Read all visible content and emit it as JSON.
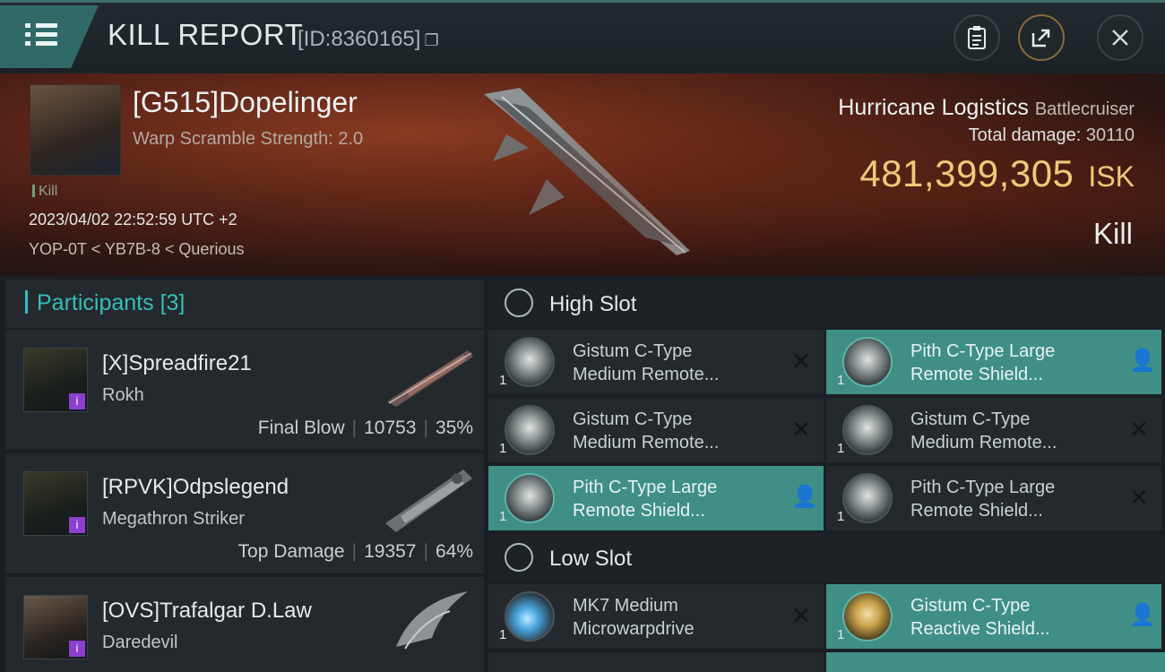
{
  "header": {
    "title": "KILL REPORT",
    "report_id": "[ID:8360165]"
  },
  "victim": {
    "name": "[G515]Dopelinger",
    "scramble": "Warp Scramble Strength: 2.0",
    "tag": "Kill",
    "datetime": "2023/04/02 22:52:59 UTC +2",
    "route": "YOP-0T < YB7B-8 < Querious",
    "ship": "Hurricane Logistics",
    "ship_class": "Battlecruiser",
    "total_damage_label": "Total damage:",
    "total_damage": "30110",
    "isk_value": "481,399,305",
    "isk_unit": "ISK",
    "result": "Kill"
  },
  "participants": {
    "title": "Participants",
    "count": "[3]",
    "rows": [
      {
        "name": "[X]Spreadfire21",
        "ship": "Rokh",
        "label": "Final Blow",
        "damage": "10753",
        "pct": "35%"
      },
      {
        "name": "[RPVK]Odpslegend",
        "ship": "Megathron Striker",
        "label": "Top Damage",
        "damage": "19357",
        "pct": "64%"
      },
      {
        "name": "[OVS]Trafalgar D.Law",
        "ship": "Daredevil",
        "label": "",
        "damage": "",
        "pct": ""
      }
    ]
  },
  "slots": {
    "high": {
      "title": "High Slot",
      "modules": [
        {
          "line1": "Gistum C-Type",
          "line2": "Medium Remote...",
          "qty": "1",
          "highlight": false,
          "action": "x"
        },
        {
          "line1": "Pith C-Type Large",
          "line2": "Remote Shield...",
          "qty": "1",
          "highlight": true,
          "action": "user"
        },
        {
          "line1": "Gistum C-Type",
          "line2": "Medium Remote...",
          "qty": "1",
          "highlight": false,
          "action": "x"
        },
        {
          "line1": "Gistum C-Type",
          "line2": "Medium Remote...",
          "qty": "1",
          "highlight": false,
          "action": "x"
        },
        {
          "line1": "Pith C-Type Large",
          "line2": "Remote Shield...",
          "qty": "1",
          "highlight": true,
          "action": "user"
        },
        {
          "line1": "Pith C-Type Large",
          "line2": "Remote Shield...",
          "qty": "1",
          "highlight": false,
          "action": "x"
        }
      ]
    },
    "low": {
      "title": "Low Slot",
      "modules": [
        {
          "line1": "MK7 Medium",
          "line2": "Microwarpdrive",
          "qty": "1",
          "highlight": false,
          "action": "x"
        },
        {
          "line1": "Gistum C-Type",
          "line2": "Reactive Shield...",
          "qty": "1",
          "highlight": true,
          "action": "user"
        }
      ]
    }
  },
  "colors": {
    "accent": "#36bfb6",
    "highlight": "#3f8f86",
    "isk": "#f0c87a"
  }
}
